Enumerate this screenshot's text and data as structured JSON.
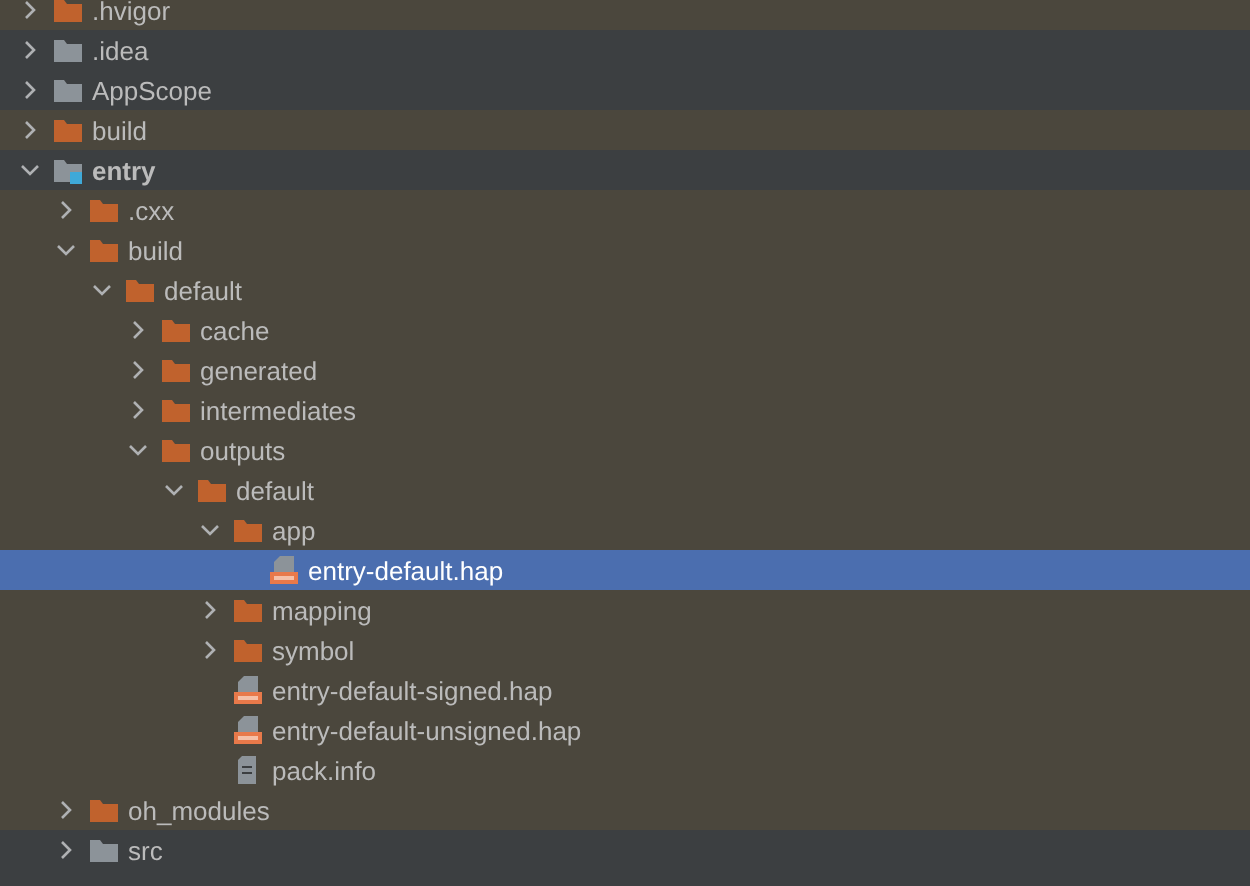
{
  "tree": [
    {
      "label": ".hvigor",
      "kind": "folder",
      "expanded": false,
      "excluded": true,
      "selected": false
    },
    {
      "label": ".idea",
      "kind": "folder",
      "expanded": false,
      "excluded": false,
      "selected": false
    },
    {
      "label": "AppScope",
      "kind": "folder",
      "expanded": false,
      "excluded": false,
      "selected": false
    },
    {
      "label": "build",
      "kind": "folder",
      "expanded": false,
      "excluded": true,
      "selected": false
    },
    {
      "label": "entry",
      "kind": "module",
      "expanded": true,
      "excluded": false,
      "selected": false,
      "children": [
        {
          "label": ".cxx",
          "kind": "folder",
          "expanded": false,
          "excluded": true,
          "selected": false
        },
        {
          "label": "build",
          "kind": "folder",
          "expanded": true,
          "excluded": true,
          "selected": false,
          "children": [
            {
              "label": "default",
              "kind": "folder",
              "expanded": true,
              "excluded": true,
              "selected": false,
              "children": [
                {
                  "label": "cache",
                  "kind": "folder",
                  "expanded": false,
                  "excluded": true,
                  "selected": false
                },
                {
                  "label": "generated",
                  "kind": "folder",
                  "expanded": false,
                  "excluded": true,
                  "selected": false
                },
                {
                  "label": "intermediates",
                  "kind": "folder",
                  "expanded": false,
                  "excluded": true,
                  "selected": false
                },
                {
                  "label": "outputs",
                  "kind": "folder",
                  "expanded": true,
                  "excluded": true,
                  "selected": false,
                  "children": [
                    {
                      "label": "default",
                      "kind": "folder",
                      "expanded": true,
                      "excluded": true,
                      "selected": false,
                      "children": [
                        {
                          "label": "app",
                          "kind": "folder",
                          "expanded": true,
                          "excluded": true,
                          "selected": false,
                          "children": [
                            {
                              "label": "entry-default.hap",
                              "kind": "hap",
                              "excluded": true,
                              "selected": true
                            }
                          ]
                        },
                        {
                          "label": "mapping",
                          "kind": "folder",
                          "expanded": false,
                          "excluded": true,
                          "selected": false
                        },
                        {
                          "label": "symbol",
                          "kind": "folder",
                          "expanded": false,
                          "excluded": true,
                          "selected": false
                        },
                        {
                          "label": "entry-default-signed.hap",
                          "kind": "hap",
                          "excluded": true,
                          "selected": false
                        },
                        {
                          "label": "entry-default-unsigned.hap",
                          "kind": "hap",
                          "excluded": true,
                          "selected": false
                        },
                        {
                          "label": "pack.info",
                          "kind": "file",
                          "excluded": true,
                          "selected": false
                        }
                      ]
                    }
                  ]
                }
              ]
            }
          ]
        },
        {
          "label": "oh_modules",
          "kind": "folder",
          "expanded": false,
          "excluded": true,
          "selected": false
        },
        {
          "label": "src",
          "kind": "folder",
          "expanded": false,
          "excluded": false,
          "selected": false
        }
      ]
    }
  ]
}
